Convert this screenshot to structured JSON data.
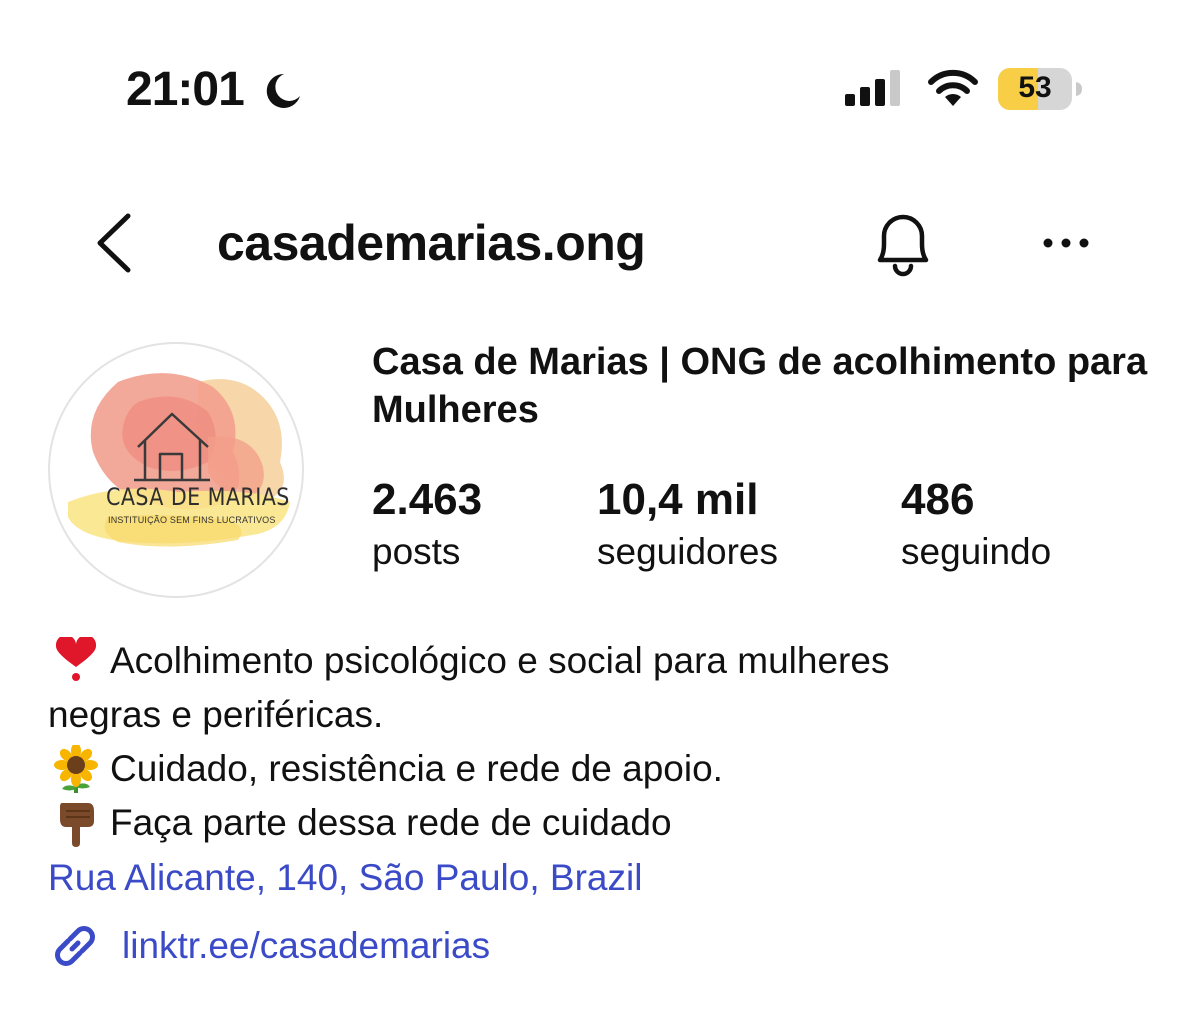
{
  "status_bar": {
    "time": "21:01",
    "focus_icon": "moon-icon",
    "signal_icon": "cellular-signal-icon",
    "wifi_icon": "wifi-icon",
    "battery_percent": "53",
    "battery_color": "#f7ce46"
  },
  "nav": {
    "back_icon": "chevron-left-icon",
    "username": "casademarias.ong",
    "notifications_icon": "bell-icon",
    "more_icon": "more-horizontal-icon"
  },
  "avatar": {
    "logo_title": "CASA DE MARIAS",
    "logo_subtitle": "INSTITUIÇÃO SEM FINS LUCRATIVOS"
  },
  "profile": {
    "display_name": "Casa de Marias | ONG de acolhimento para Mulheres",
    "stats": [
      {
        "value": "2.463",
        "label": "posts"
      },
      {
        "value": "10,4 mil",
        "label": "seguidores"
      },
      {
        "value": "486",
        "label": "seguindo"
      }
    ]
  },
  "bio": {
    "lines": [
      {
        "emoji": "heart-exclamation-icon",
        "text": "Acolhimento psicológico e social para mulheres"
      },
      {
        "emoji": "",
        "text": "negras e periféricas."
      },
      {
        "emoji": "sunflower-icon",
        "text": "Cuidado, resistência e rede de apoio."
      },
      {
        "emoji": "pointing-down-hand-icon",
        "text": "Faça parte dessa rede de cuidado"
      }
    ],
    "address": "Rua Alicante, 140, São Paulo, Brazil",
    "link_icon": "link-icon",
    "link": "linktr.ee/casademarias"
  },
  "colors": {
    "link": "#3b4bc8",
    "text": "#111111"
  }
}
